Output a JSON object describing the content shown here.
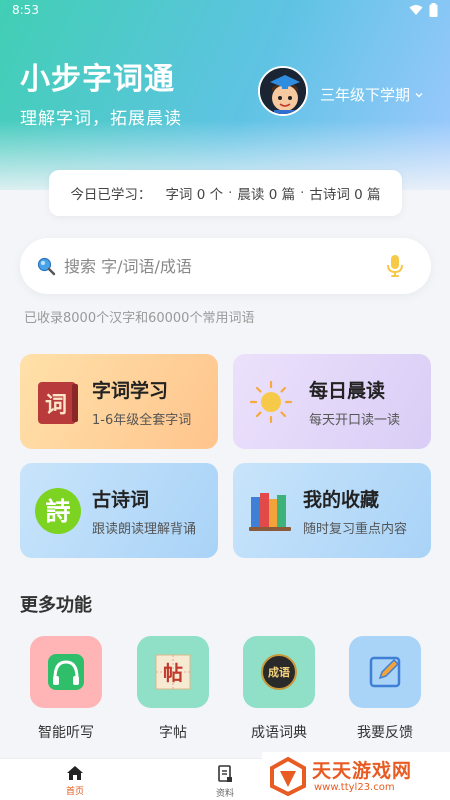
{
  "status": {
    "time": "8:53"
  },
  "header": {
    "title": "小步字词通",
    "subtitle": "理解字词，拓展晨读",
    "grade": "三年级下学期"
  },
  "stats": {
    "label": "今日已学习：",
    "words": "字词 0 个",
    "reading": "晨读 0 篇",
    "poems": "古诗词 0 篇",
    "separator": "·"
  },
  "search": {
    "placeholder": "搜索 字/词语/成语",
    "note": "已收录8000个汉字和60000个常用词语"
  },
  "cards": [
    {
      "title": "字词学习",
      "desc": "1-6年级全套字词",
      "icon_text": "词"
    },
    {
      "title": "每日晨读",
      "desc": "每天开口读一读"
    },
    {
      "title": "古诗词",
      "desc": "跟读朗读理解背诵",
      "icon_text": "詩"
    },
    {
      "title": "我的收藏",
      "desc": "随时复习重点内容"
    }
  ],
  "more": {
    "title": "更多功能",
    "items": [
      {
        "label": "智能听写",
        "color": "#ffb5b5"
      },
      {
        "label": "字帖",
        "color": "#8fe0c6",
        "icon_text": "帖"
      },
      {
        "label": "成语词典",
        "color": "#8fe0c6",
        "icon_text": "成语"
      },
      {
        "label": "我要反馈",
        "color": "#a9d3f7"
      }
    ]
  },
  "nav": [
    {
      "label": "首页"
    },
    {
      "label": "资料"
    }
  ],
  "watermark": {
    "text": "天天游戏网",
    "url": "www.ttyl23.com"
  },
  "colors": {
    "accent": "#e05a1a",
    "header_start": "#41cfb4",
    "header_end": "#9fc9ff"
  }
}
